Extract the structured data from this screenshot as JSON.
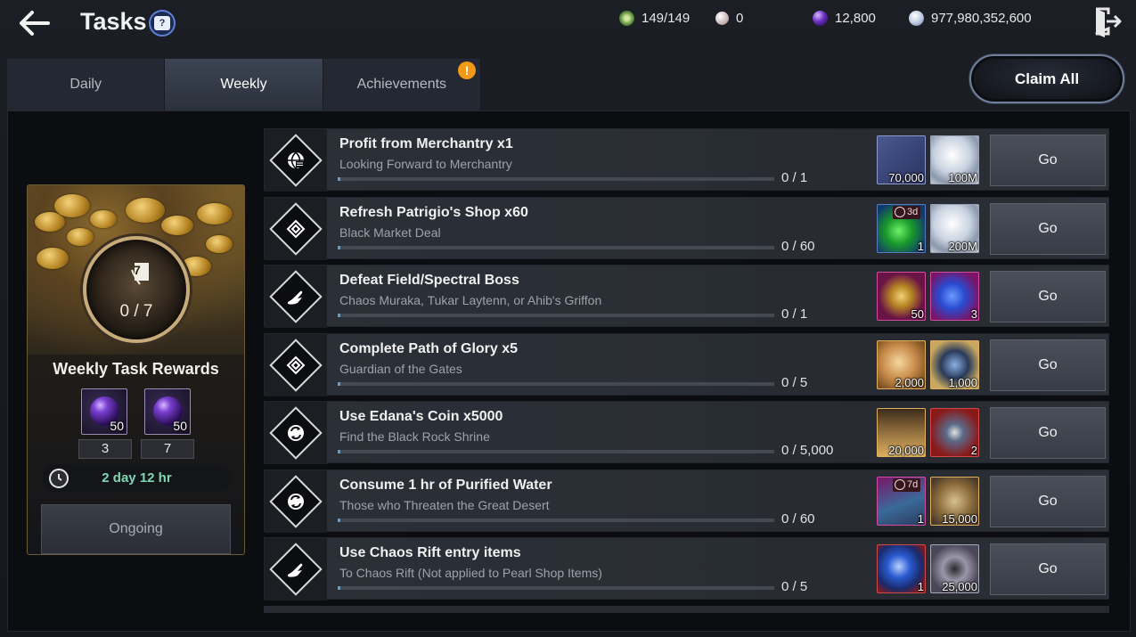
{
  "header": {
    "title": "Tasks"
  },
  "currencies": [
    {
      "name": "stamina",
      "icon": "green-clover-icon",
      "value": "149/149",
      "color": "#7fbf5a"
    },
    {
      "name": "pearl",
      "icon": "pearl-icon",
      "value": "0",
      "color": "#d8c8c8"
    },
    {
      "name": "chaos-orb",
      "icon": "purple-orb-icon",
      "value": "12,800",
      "color": "#7a3fd1"
    },
    {
      "name": "silver",
      "icon": "silver-coin-icon",
      "value": "977,980,352,600",
      "color": "#b8c8e0"
    }
  ],
  "tabs": [
    {
      "label": "Daily",
      "active": false
    },
    {
      "label": "Weekly",
      "active": true
    },
    {
      "label": "Achievements",
      "active": false,
      "badge": "!"
    }
  ],
  "claim_all": "Claim All",
  "reward_card": {
    "progress": "0 / 7",
    "medal_number": "7",
    "title": "Weekly Task Rewards",
    "rewards": [
      {
        "icon": "purple-orb-icon",
        "qty": "50",
        "required": "3"
      },
      {
        "icon": "purple-orb-icon",
        "qty": "50",
        "required": "7"
      }
    ],
    "timer": "2 day 12 hr",
    "status": "Ongoing"
  },
  "tasks": [
    {
      "title": "Profit from Merchantry x1",
      "subtitle": "Looking Forward to Merchantry",
      "progress": "0 / 1",
      "fraction": 0.0,
      "icon": "merchant-icon",
      "items": [
        {
          "icon": "crystal-bundle-icon",
          "qty": "70,000",
          "tag": "",
          "bg": "#3c4a78"
        },
        {
          "icon": "silver-coin-icon",
          "qty": "100M",
          "tag": "",
          "bg": "#d0d6de"
        }
      ],
      "go": "Go"
    },
    {
      "title": "Refresh Patrigio's Shop x60",
      "subtitle": "Black Market Deal",
      "progress": "0 / 60",
      "fraction": 0.0,
      "icon": "shop-refresh-icon",
      "items": [
        {
          "icon": "green-potion-icon",
          "qty": "1",
          "tag": "3d",
          "bg": "#1d3a6e"
        },
        {
          "icon": "silver-coin-icon",
          "qty": "200M",
          "tag": "",
          "bg": "#d0d6de"
        }
      ],
      "go": "Go"
    },
    {
      "title": "Defeat Field/Spectral Boss",
      "subtitle": "Chaos Muraka, Tukar Laytenn, or Ahib's Griffon",
      "progress": "0 / 1",
      "fraction": 0.0,
      "icon": "boss-hand-icon",
      "items": [
        {
          "icon": "golden-flower-icon",
          "qty": "50",
          "tag": "",
          "bg": "#7a1a56"
        },
        {
          "icon": "blue-crystal-icon",
          "qty": "3",
          "tag": "",
          "bg": "#8a1a6a"
        }
      ],
      "go": "Go"
    },
    {
      "title": "Complete Path of Glory x5",
      "subtitle": "Guardian of the Gates",
      "progress": "0 / 5",
      "fraction": 0.0,
      "icon": "glory-path-icon",
      "items": [
        {
          "icon": "gold-medal-icon",
          "qty": "2,000",
          "tag": "",
          "bg": "#8a6a2a"
        },
        {
          "icon": "compass-emblem-icon",
          "qty": "1,000",
          "tag": "",
          "bg": "#7a6a3a"
        }
      ],
      "go": "Go"
    },
    {
      "title": "Use Edana's Coin x5000",
      "subtitle": "Find the Black Rock Shrine",
      "progress": "0 / 5,000",
      "fraction": 0.0,
      "icon": "coin-cycle-icon",
      "items": [
        {
          "icon": "sand-pile-icon",
          "qty": "20,000",
          "tag": "",
          "bg": "#8a6a2a"
        },
        {
          "icon": "scroll-tome-icon",
          "qty": "2",
          "tag": "",
          "bg": "#8a1a1a"
        }
      ],
      "go": "Go"
    },
    {
      "title": "Consume 1 hr of Purified Water",
      "subtitle": "Those who Threaten the Great Desert",
      "progress": "0 / 60",
      "fraction": 0.0,
      "icon": "water-cycle-icon",
      "items": [
        {
          "icon": "ticket-icon",
          "qty": "1",
          "tag": "7d",
          "bg": "#8a1a6a"
        },
        {
          "icon": "bronze-shield-icon",
          "qty": "15,000",
          "tag": "",
          "bg": "#7a6a3a"
        }
      ],
      "go": "Go"
    },
    {
      "title": "Use Chaos Rift entry items",
      "subtitle": "To Chaos Rift (Not applied to Pearl Shop Items)",
      "progress": "0 / 5",
      "fraction": 0.0,
      "icon": "rift-hand-icon",
      "items": [
        {
          "icon": "blue-orb-icon",
          "qty": "1",
          "tag": "",
          "bg": "#8a1a1a"
        },
        {
          "icon": "gear-ring-icon",
          "qty": "25,000",
          "tag": "",
          "bg": "#5a5868"
        }
      ],
      "go": "Go"
    }
  ]
}
